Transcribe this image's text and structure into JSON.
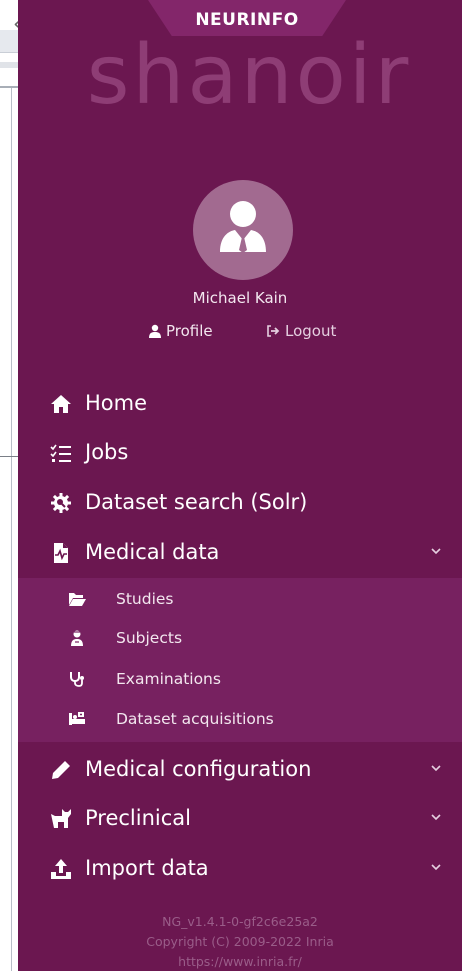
{
  "app": {
    "tab_title": "NEURINFO",
    "logo_text": "shanoir"
  },
  "user": {
    "name": "Michael Kain",
    "profile_label": "Profile",
    "logout_label": "Logout"
  },
  "nav": {
    "home": "Home",
    "jobs": "Jobs",
    "dataset_search": "Dataset search (Solr)",
    "medical_data": "Medical data",
    "medical_configuration": "Medical configuration",
    "preclinical": "Preclinical",
    "import_data": "Import data"
  },
  "submenu": {
    "studies": "Studies",
    "subjects": "Subjects",
    "examinations": "Examinations",
    "dataset_acquisitions": "Dataset acquisitions"
  },
  "footer": {
    "version": "NG_v1.4.1-0-gf2c6e25a2",
    "copyright": "Copyright (C) 2009-2022 Inria",
    "url": "https://www.inria.fr/"
  },
  "icons": {
    "collapse": "chevron-left-icon",
    "home": "home-icon",
    "jobs": "list-check-icon",
    "dataset_search": "gear-search-icon",
    "medical_data": "file-medical-icon",
    "studies": "folder-open-icon",
    "subjects": "user-injured-icon",
    "examinations": "stethoscope-icon",
    "dataset_acquisitions": "procedures-icon",
    "medical_configuration": "pen-icon",
    "preclinical": "cat-icon",
    "import_data": "upload-icon"
  },
  "colors": {
    "sidebar_bg": "#6b1750",
    "submenu_bg": "#772160",
    "accent_tab": "#83266a",
    "logo": "#8e3d75"
  }
}
